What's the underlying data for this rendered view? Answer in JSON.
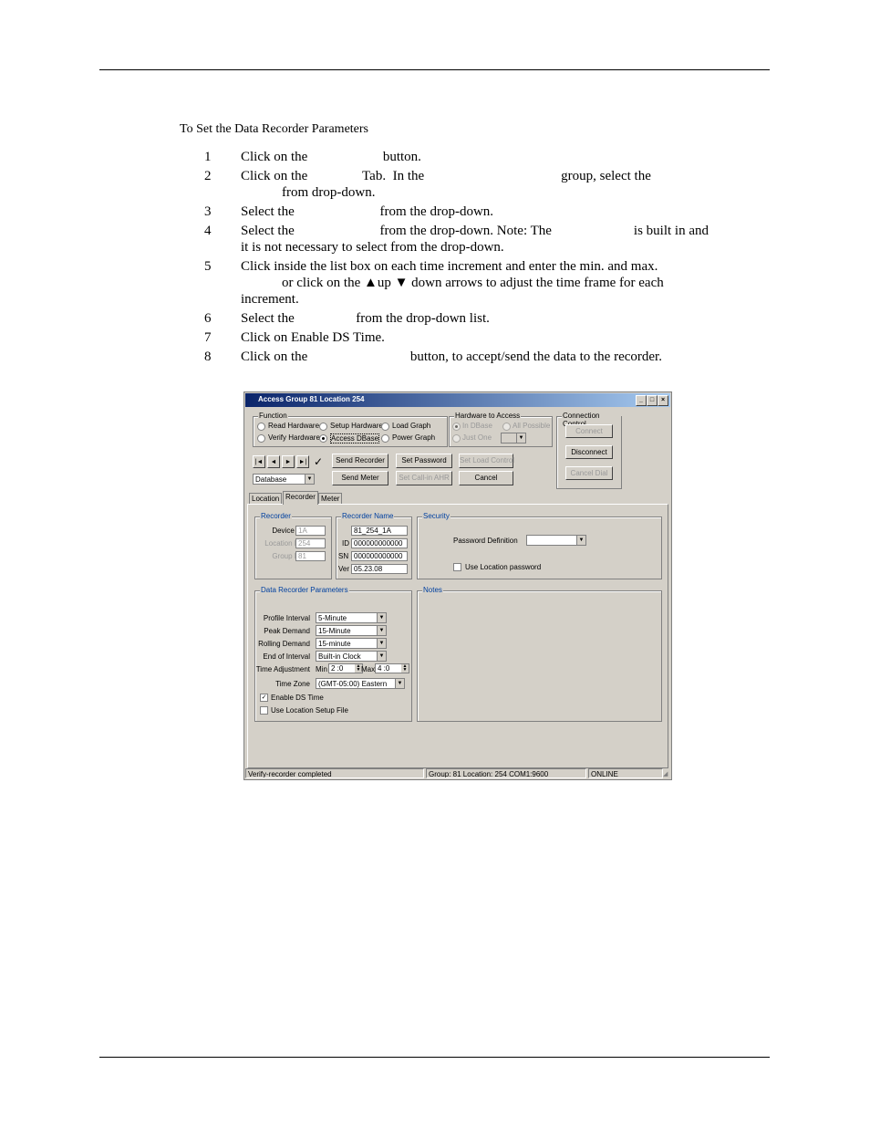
{
  "doc": {
    "heading": "To Set the Data Recorder Parameters",
    "steps": [
      {
        "num": "1",
        "lines": [
          "Click on the                      button."
        ]
      },
      {
        "num": "2",
        "lines": [
          "Click on the                Tab.  In the                                        group, select the",
          "            from drop-down."
        ]
      },
      {
        "num": "3",
        "lines": [
          "Select the                         from the drop-down."
        ]
      },
      {
        "num": "4",
        "lines": [
          "Select the                         from the drop-down. Note: The                        is built in and",
          "it is not necessary to select from the drop-down."
        ]
      },
      {
        "num": "5",
        "lines": [
          "Click inside the list box on each time increment and enter the min. and max.",
          "            or click on the ▲up ▼ down arrows to adjust the time frame for each",
          "increment."
        ]
      },
      {
        "num": "6",
        "lines": [
          "Select the                  from the drop-down list."
        ]
      },
      {
        "num": "7",
        "lines": [
          "Click on Enable DS Time."
        ]
      },
      {
        "num": "8",
        "lines": [
          "Click on the                              button, to accept/send the data to the recorder."
        ]
      }
    ]
  },
  "window": {
    "title": "Access Group 81 Location 254",
    "function": {
      "label": "Function",
      "options": [
        "Read Hardware",
        "Setup Hardware",
        "Load Graph",
        "Verify Hardware",
        "Access DBase",
        "Power Graph"
      ]
    },
    "hardware": {
      "label": "Hardware to Access",
      "in_dbase": "In DBase",
      "all_possible": "All Possible",
      "just_one": "Just One"
    },
    "connection": {
      "label": "Connection Control",
      "connect": "Connect",
      "disconnect": "Disconnect",
      "cancel_dial": "Cancel Dial"
    },
    "nav": {
      "first": "|◄",
      "prev": "◄",
      "next": "►",
      "last": "►|",
      "check": "✓"
    },
    "buttons": {
      "send_recorder": "Send Recorder",
      "set_password": "Set Password",
      "set_load_control": "Set Load Control",
      "send_meter": "Send Meter",
      "set_callin": "Set Call-in AHR",
      "cancel": "Cancel"
    },
    "source_select": "Database",
    "tabs": [
      "Location",
      "Recorder",
      "Meter"
    ],
    "recorder": {
      "label": "Recorder",
      "device_id_label": "Device ID",
      "device_id": "1A",
      "location_no_label": "Location No",
      "location_no": "254",
      "group_no_label": "Group No",
      "group_no": "81"
    },
    "recorder_name": {
      "label": "Recorder Name",
      "name": "81_254_1A",
      "id_label": "ID",
      "id": "000000000000",
      "sn_label": "SN",
      "sn": "000000000000",
      "ver_label": "Ver",
      "ver": "05.23.08"
    },
    "security": {
      "label": "Security",
      "password_def_label": "Password Definition",
      "use_location_password": "Use Location password"
    },
    "params": {
      "label": "Data Recorder Parameters",
      "profile_interval_label": "Profile Interval",
      "profile_interval": "5-Minute",
      "peak_demand_label": "Peak Demand",
      "peak_demand": "15-Minute",
      "rolling_demand_label": "Rolling Demand",
      "rolling_demand": "15-minute",
      "end_interval_label": "End of Interval",
      "end_interval": "Built-in Clock",
      "time_adj_label": "Time Adjustment",
      "min_label": "Min",
      "min_value": "2  :0",
      "max_label": "Max",
      "max_value": "4  :0",
      "time_zone_label": "Time Zone",
      "time_zone": "(GMT-05:00)  Eastern",
      "enable_ds": "Enable DS Time",
      "use_location_setup": "Use Location Setup File"
    },
    "notes": {
      "label": "Notes"
    },
    "status": {
      "message": "Verify-recorder completed",
      "group_info": "Group: 81 Location: 254 COM1:9600",
      "state": "ONLINE"
    }
  }
}
